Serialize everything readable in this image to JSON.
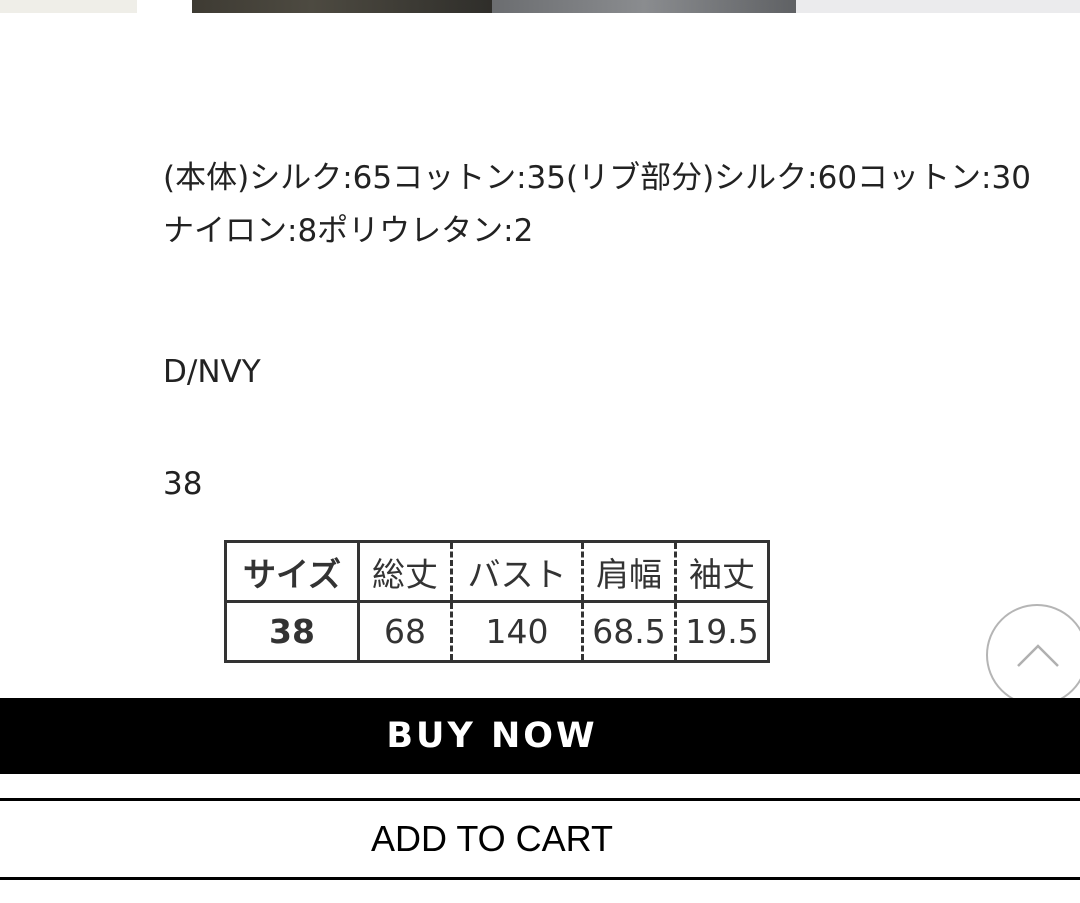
{
  "product": {
    "material": "(本体)シルク:65コットン:35(リブ部分)シルク:60コットン:30ナイロン:8ポリウレタン:2",
    "color": "D/NVY",
    "size": "38"
  },
  "size_table": {
    "headers": [
      "サイズ",
      "総丈",
      "バスト",
      "肩幅",
      "袖丈"
    ],
    "rows": [
      [
        "38",
        "68",
        "140",
        "68.5",
        "19.5"
      ]
    ]
  },
  "actions": {
    "buy_now_label": "BUY NOW",
    "add_to_cart_label": "ADD TO CART"
  },
  "icons": {
    "scroll_top": "chevron-up-icon"
  }
}
